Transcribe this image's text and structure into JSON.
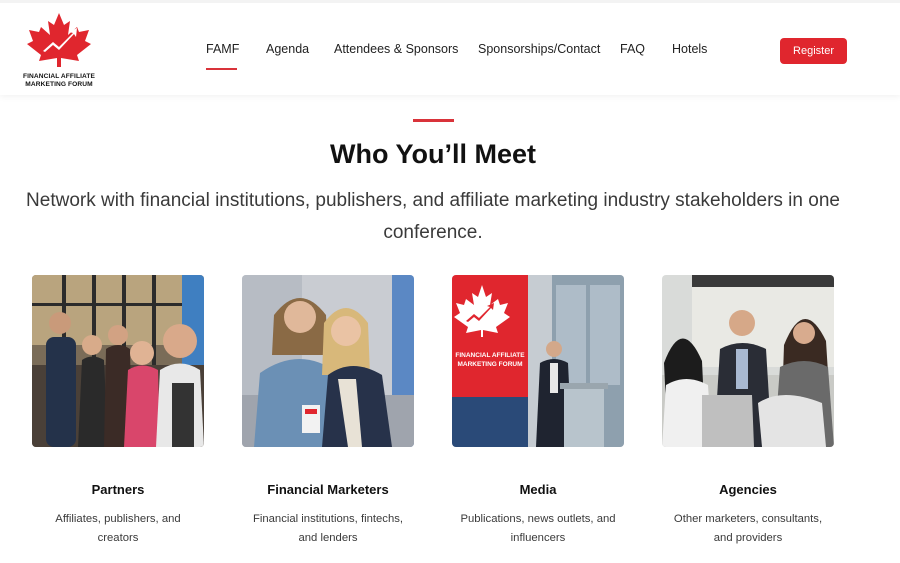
{
  "brand": {
    "logo_icon": "maple-leaf-icon",
    "name_line1": "FINANCIAL AFFILIATE",
    "name_line2": "MARKETING FORUM",
    "accent_color": "#e0262e"
  },
  "nav": {
    "items": [
      {
        "label": "FAMF",
        "active": true
      },
      {
        "label": "Agenda"
      },
      {
        "label": "Attendees & Sponsors"
      },
      {
        "label": "Sponsorships/Contact"
      },
      {
        "label": "FAQ"
      },
      {
        "label": "Hotels"
      }
    ],
    "register_label": "Register"
  },
  "section": {
    "title": "Who You’ll Meet",
    "subtitle_line1": "Network with financial institutions, publishers, and affiliate marketing industry stakeholders in one",
    "subtitle_line2": "conference."
  },
  "cards": [
    {
      "title": "Partners",
      "desc_line1": "Affiliates, publishers, and",
      "desc_line2": "creators",
      "photo": "group-selfie-photo"
    },
    {
      "title": "Financial Marketers",
      "desc_line1": "Financial institutions, fintechs,",
      "desc_line2": "and lenders",
      "photo": "two-attendees-photo"
    },
    {
      "title": "Media",
      "desc_line1": "Publications, news outlets, and",
      "desc_line2": "influencers",
      "photo": "stage-speaker-photo",
      "photo_sign_line1": "FINANCIAL AFFILIATE",
      "photo_sign_line2": "MARKETING FORUM"
    },
    {
      "title": "Agencies",
      "desc_line1": "Other marketers, consultants,",
      "desc_line2": "and providers",
      "photo": "meeting-photo"
    }
  ]
}
